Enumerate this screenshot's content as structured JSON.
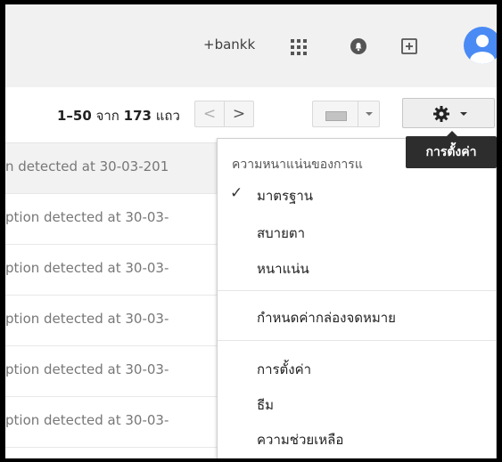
{
  "header": {
    "account_link": "+bankk",
    "icons": {
      "apps": "apps-grid-icon",
      "notifications": "notifications-bell-icon",
      "share": "share-plus-icon",
      "avatar": "account-avatar"
    },
    "colors": {
      "topbar_bg": "#f1f1f1",
      "avatar_bg": "#4a8af4"
    }
  },
  "toolbar": {
    "pager": {
      "range": "1–50",
      "of_word": "จาก",
      "total": "173",
      "unit": "แถว"
    },
    "prev_label": "<",
    "next_label": ">",
    "keyboard_icon": "keyboard-icon",
    "settings_icon": "gear-icon"
  },
  "messages": [
    {
      "snippet": "n detected at 30-03-201"
    },
    {
      "snippet": "ption detected at 30-03-"
    },
    {
      "snippet": "ption detected at 30-03-"
    },
    {
      "snippet": "ption detected at 30-03-"
    },
    {
      "snippet": "ption detected at 30-03-"
    },
    {
      "snippet": "ption detected at 30-03-"
    }
  ],
  "settings_menu": {
    "density_heading": "ความหนาแน่นของการแ",
    "density_options": [
      {
        "label": "มาตรฐาน",
        "selected": true
      },
      {
        "label": "สบายตา",
        "selected": false
      },
      {
        "label": "หนาแน่น",
        "selected": false
      }
    ],
    "check_mark": "✓",
    "configure_inbox": "กำหนดค่ากล่องจดหมาย",
    "settings": "การตั้งค่า",
    "themes": "ธีม",
    "help": "ความช่วยเหลือ"
  },
  "tooltip": {
    "text": "การตั้งค่า"
  }
}
